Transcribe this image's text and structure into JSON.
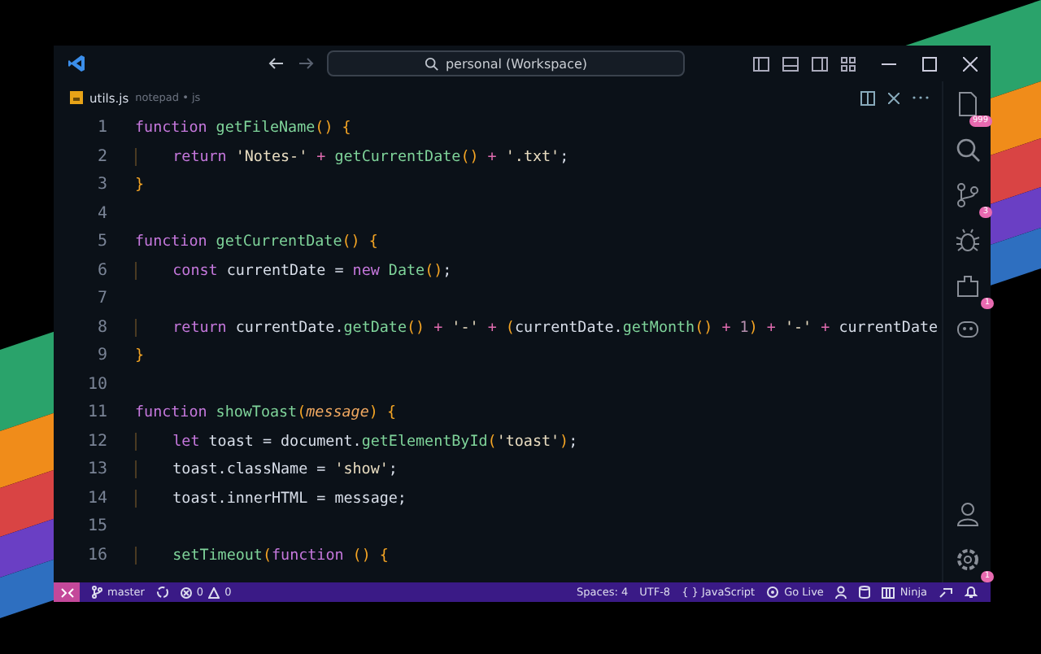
{
  "title_bar": {
    "search": "personal (Workspace)"
  },
  "tab": {
    "file_name": "utils.js",
    "description": "notepad • js"
  },
  "activity_bar": {
    "badges": {
      "explorer": "999",
      "source_control": "3",
      "extensions": "1",
      "settings": "1"
    }
  },
  "code": {
    "lines": [
      {
        "number": "1",
        "indent": false,
        "tokens": [
          {
            "kind": "keyword",
            "text": "function "
          },
          {
            "kind": "function",
            "text": "getFileName"
          },
          {
            "kind": "paren",
            "text": "() {"
          }
        ]
      },
      {
        "number": "2",
        "indent": true,
        "tokens": [
          {
            "kind": "keyword",
            "text": "return "
          },
          {
            "kind": "string",
            "text": "'Notes-'"
          },
          {
            "kind": "operator",
            "text": " + "
          },
          {
            "kind": "function",
            "text": "getCurrentDate"
          },
          {
            "kind": "paren",
            "text": "()"
          },
          {
            "kind": "operator",
            "text": " + "
          },
          {
            "kind": "string",
            "text": "'.txt'"
          },
          {
            "kind": "plain",
            "text": ";"
          }
        ]
      },
      {
        "number": "3",
        "indent": false,
        "tokens": [
          {
            "kind": "paren",
            "text": "}"
          }
        ]
      },
      {
        "number": "4"
      },
      {
        "number": "5",
        "indent": false,
        "tokens": [
          {
            "kind": "keyword",
            "text": "function "
          },
          {
            "kind": "function",
            "text": "getCurrentDate"
          },
          {
            "kind": "paren",
            "text": "() {"
          }
        ]
      },
      {
        "number": "6",
        "indent": true,
        "tokens": [
          {
            "kind": "keyword",
            "text": "const "
          },
          {
            "kind": "plain",
            "text": "currentDate = "
          },
          {
            "kind": "keyword",
            "text": "new "
          },
          {
            "kind": "function",
            "text": "Date"
          },
          {
            "kind": "paren",
            "text": "()"
          },
          {
            "kind": "plain",
            "text": ";"
          }
        ]
      },
      {
        "number": "7"
      },
      {
        "number": "8",
        "indent": true,
        "tokens": [
          {
            "kind": "keyword",
            "text": "return "
          },
          {
            "kind": "plain",
            "text": "currentDate."
          },
          {
            "kind": "function",
            "text": "getDate"
          },
          {
            "kind": "paren",
            "text": "()"
          },
          {
            "kind": "operator",
            "text": " + "
          },
          {
            "kind": "string",
            "text": "'-'"
          },
          {
            "kind": "operator",
            "text": " + "
          },
          {
            "kind": "paren",
            "text": "("
          },
          {
            "kind": "plain",
            "text": "currentDate."
          },
          {
            "kind": "function",
            "text": "getMonth"
          },
          {
            "kind": "paren",
            "text": "()"
          },
          {
            "kind": "operator",
            "text": " + "
          },
          {
            "kind": "number",
            "text": "1"
          },
          {
            "kind": "paren",
            "text": ")"
          },
          {
            "kind": "operator",
            "text": " + "
          },
          {
            "kind": "string",
            "text": "'-'"
          },
          {
            "kind": "operator",
            "text": " + "
          },
          {
            "kind": "plain",
            "text": "currentDate"
          }
        ]
      },
      {
        "number": "9",
        "indent": false,
        "tokens": [
          {
            "kind": "paren",
            "text": "}"
          }
        ]
      },
      {
        "number": "10"
      },
      {
        "number": "11",
        "indent": false,
        "tokens": [
          {
            "kind": "keyword",
            "text": "function "
          },
          {
            "kind": "function",
            "text": "showToast"
          },
          {
            "kind": "paren",
            "text": "("
          },
          {
            "kind": "param",
            "text": "message"
          },
          {
            "kind": "paren",
            "text": ") {"
          }
        ]
      },
      {
        "number": "12",
        "indent": true,
        "tokens": [
          {
            "kind": "keyword",
            "text": "let "
          },
          {
            "kind": "plain",
            "text": "toast = document."
          },
          {
            "kind": "function",
            "text": "getElementById"
          },
          {
            "kind": "paren",
            "text": "("
          },
          {
            "kind": "string",
            "text": "'toast'"
          },
          {
            "kind": "paren",
            "text": ")"
          },
          {
            "kind": "plain",
            "text": ";"
          }
        ]
      },
      {
        "number": "13",
        "indent": true,
        "tokens": [
          {
            "kind": "plain",
            "text": "toast.className = "
          },
          {
            "kind": "string",
            "text": "'show'"
          },
          {
            "kind": "plain",
            "text": ";"
          }
        ]
      },
      {
        "number": "14",
        "indent": true,
        "tokens": [
          {
            "kind": "plain",
            "text": "toast.innerHTML = message;"
          }
        ]
      },
      {
        "number": "15"
      },
      {
        "number": "16",
        "indent": true,
        "tokens": [
          {
            "kind": "function",
            "text": "setTimeout"
          },
          {
            "kind": "paren",
            "text": "("
          },
          {
            "kind": "keyword",
            "text": "function "
          },
          {
            "kind": "paren",
            "text": "() {"
          }
        ]
      }
    ]
  },
  "status_bar": {
    "branch": "master",
    "errors": "0",
    "warnings": "0",
    "items": [
      {
        "kind": "text",
        "text": "Spaces: 4"
      },
      {
        "kind": "text",
        "text": "UTF-8"
      },
      {
        "kind": "language",
        "text": "{ } JavaScript"
      },
      {
        "kind": "golive",
        "text": "Go Live"
      },
      {
        "kind": "layout",
        "text": "Ninja"
      }
    ]
  }
}
